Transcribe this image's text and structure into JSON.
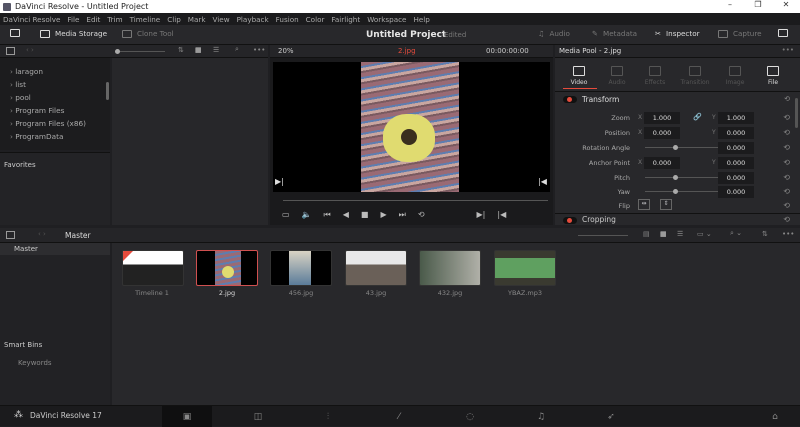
{
  "window": {
    "title": "DaVinci Resolve - Untitled Project",
    "min": "–",
    "max": "❐",
    "close": "✕"
  },
  "menu": [
    "DaVinci Resolve",
    "File",
    "Edit",
    "Trim",
    "Timeline",
    "Clip",
    "Mark",
    "View",
    "Playback",
    "Fusion",
    "Color",
    "Fairlight",
    "Workspace",
    "Help"
  ],
  "toolbar": {
    "media_storage": "Media Storage",
    "clone_tool": "Clone Tool",
    "project": "Untitled Project",
    "status": "Edited",
    "audio": "Audio",
    "metadata": "Metadata",
    "inspector": "Inspector",
    "capture": "Capture"
  },
  "viewer": {
    "zoom": "20%",
    "clip": "2.jpg",
    "timecode": "00:00:00:00"
  },
  "storage": {
    "folders": [
      "laragon",
      "list",
      "pool",
      "Program Files",
      "Program Files (x86)",
      "ProgramData"
    ],
    "favorites": "Favorites"
  },
  "inspector": {
    "title": "Media Pool - 2.jpg",
    "tabs": [
      "Video",
      "Audio",
      "Effects",
      "Transition",
      "Image",
      "File"
    ],
    "section": "Transform",
    "next_section": "Cropping",
    "zoom": {
      "label": "Zoom",
      "x": "1.000",
      "y": "1.000"
    },
    "position": {
      "label": "Position",
      "x": "0.000",
      "y": "0.000"
    },
    "rotation": {
      "label": "Rotation Angle",
      "value": "0.000"
    },
    "anchor": {
      "label": "Anchor Point",
      "x": "0.000",
      "y": "0.000"
    },
    "pitch": {
      "label": "Pitch",
      "value": "0.000"
    },
    "yaw": {
      "label": "Yaw",
      "value": "0.000"
    },
    "flip": {
      "label": "Flip"
    },
    "x": "X",
    "y": "Y"
  },
  "pool": {
    "breadcrumb": "Master",
    "bins": [
      "Master"
    ],
    "smart_bins": "Smart Bins",
    "keywords": "Keywords",
    "clips": [
      "Timeline 1",
      "2.jpg",
      "456.jpg",
      "43.jpg",
      "432.jpg",
      "YBAZ.mp3"
    ]
  },
  "footer": {
    "app": "DaVinci Resolve 17"
  },
  "colors": {
    "accent": "#e64b3c",
    "selected": "#d05050"
  }
}
